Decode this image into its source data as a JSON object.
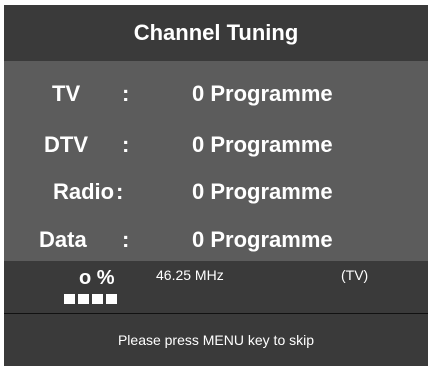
{
  "title": "Channel Tuning",
  "rows": [
    {
      "label": "TV",
      "colon": ":",
      "value": "0 Programme"
    },
    {
      "label": "DTV",
      "colon": ":",
      "value": "0 Programme"
    },
    {
      "label": "Radio",
      "colon": ":",
      "value": "0 Programme"
    },
    {
      "label": "Data",
      "colon": ":",
      "value": "0 Programme"
    }
  ],
  "status": {
    "progress_text": "o %",
    "frequency": "46.25 MHz",
    "band": "(TV)",
    "progress_fraction": 0.25,
    "progress_blocks_filled": 4
  },
  "footer": {
    "hint": "Please press MENU key to skip"
  },
  "colors": {
    "panel": "#3a3a3a",
    "rows_background": "#5c5c5c",
    "text": "#ffffff"
  }
}
